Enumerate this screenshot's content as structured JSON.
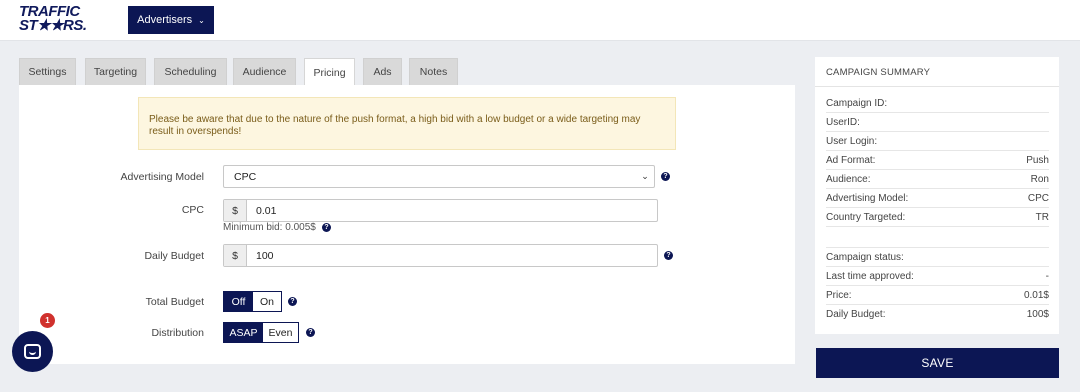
{
  "header": {
    "logo_line1": "TRAFFIC",
    "logo_line2": "ST★★RS.",
    "advertisers_label": "Advertisers"
  },
  "tabs": [
    {
      "label": "Settings"
    },
    {
      "label": "Targeting"
    },
    {
      "label": "Scheduling"
    },
    {
      "label": "Audience"
    },
    {
      "label": "Pricing",
      "active": true
    },
    {
      "label": "Ads"
    },
    {
      "label": "Notes"
    }
  ],
  "pricing": {
    "warning": "Please be aware that due to the nature of the push format, a high bid with a low budget or a wide targeting may result in overspends!",
    "advertising_model_label": "Advertising Model",
    "advertising_model_value": "CPC",
    "cpc_label": "CPC",
    "cpc_currency": "$",
    "cpc_value": "0.01",
    "min_bid": "Minimum bid: 0.005$",
    "daily_budget_label": "Daily Budget",
    "daily_budget_currency": "$",
    "daily_budget_value": "100",
    "total_budget_label": "Total Budget",
    "total_budget_off": "Off",
    "total_budget_on": "On",
    "total_budget_selected": "Off",
    "distribution_label": "Distribution",
    "distribution_asap": "ASAP",
    "distribution_even": "Even",
    "distribution_selected": "ASAP",
    "help_glyph": "?"
  },
  "chat": {
    "badge_count": "1"
  },
  "summary": {
    "title": "CAMPAIGN SUMMARY",
    "rows": [
      {
        "label": "Campaign ID:",
        "value": ""
      },
      {
        "label": "UserID:",
        "value": ""
      },
      {
        "label": "User Login:",
        "value": ""
      },
      {
        "label": "Ad Format:",
        "value": "Push"
      },
      {
        "label": "Audience:",
        "value": "Ron"
      },
      {
        "label": "Advertising Model:",
        "value": "CPC"
      },
      {
        "label": "Country Targeted:",
        "value": "TR"
      },
      {
        "label": "",
        "value": ""
      },
      {
        "label": "Campaign status:",
        "value": ""
      },
      {
        "label": "Last time approved:",
        "value": "-"
      },
      {
        "label": "Price:",
        "value": "0.01$"
      },
      {
        "label": "Daily Budget:",
        "value": "100$"
      }
    ],
    "save_label": "SAVE"
  },
  "colors": {
    "brand_navy": "#0c1654",
    "warning_bg": "#fdf6e0",
    "badge_red": "#d0312d"
  }
}
